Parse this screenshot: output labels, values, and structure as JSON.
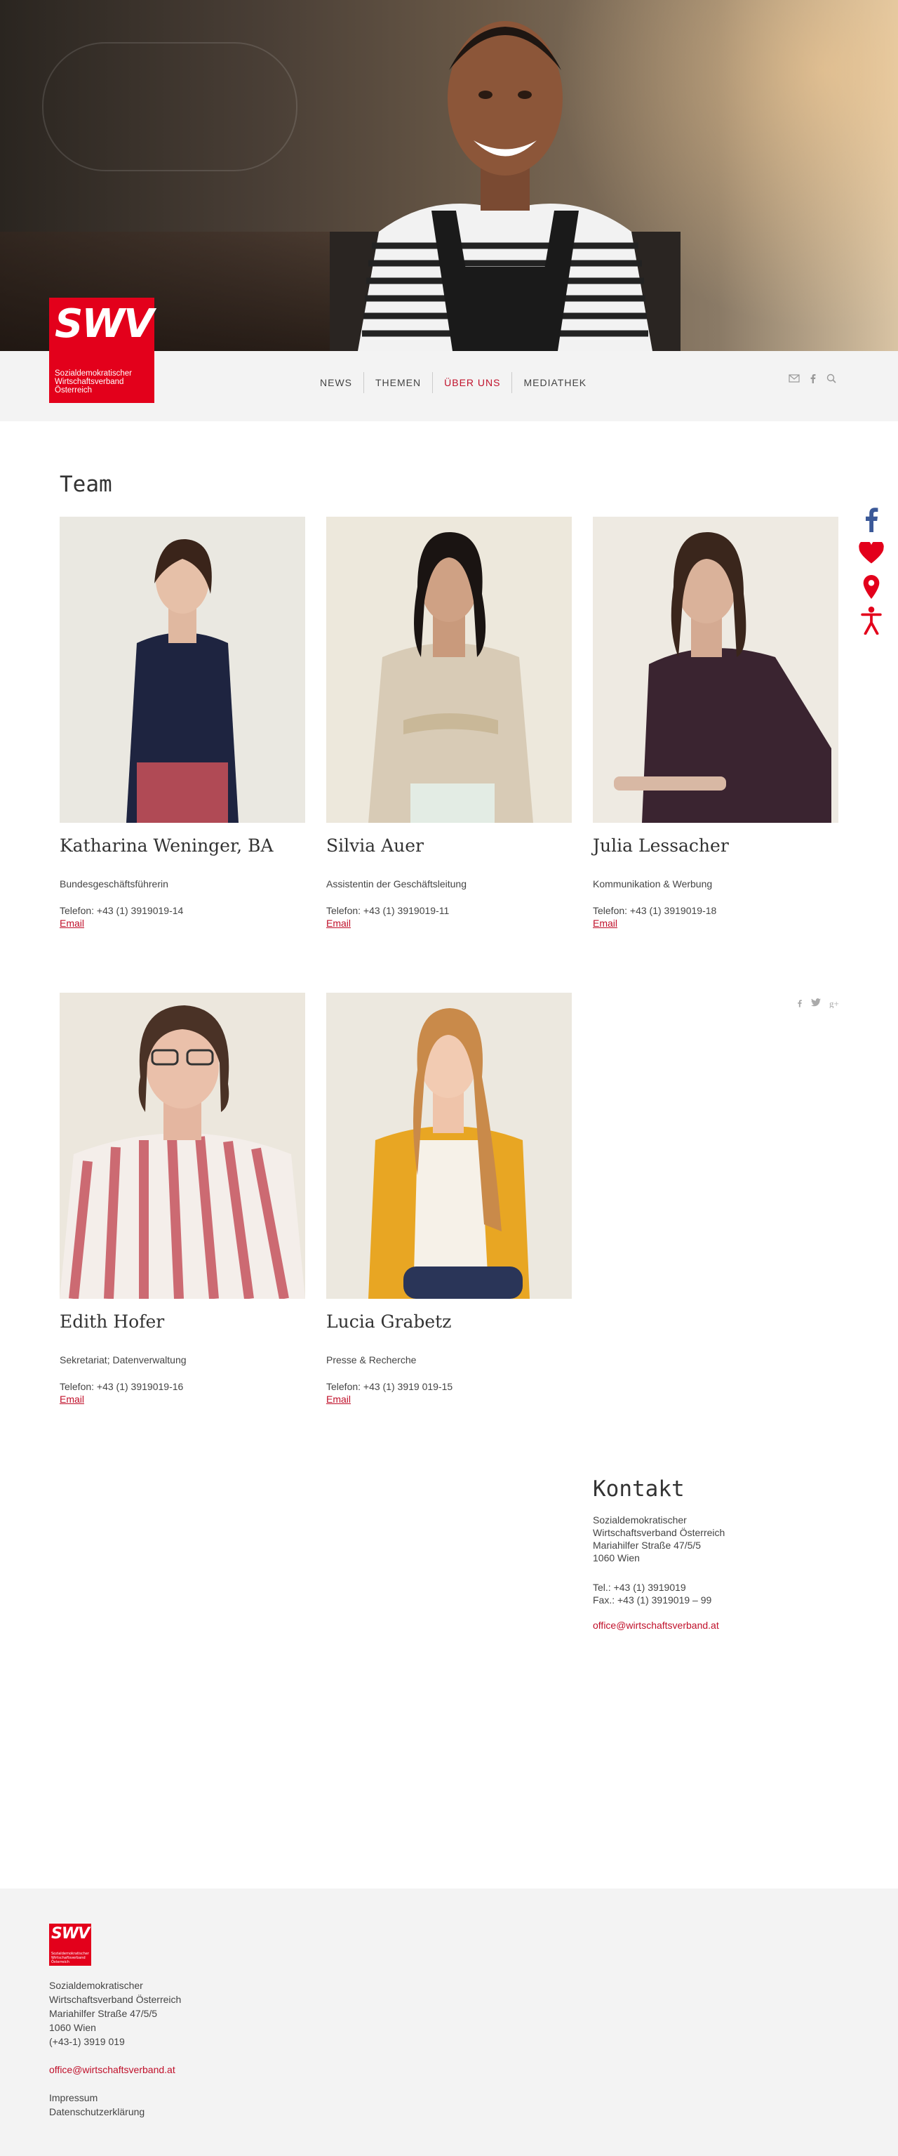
{
  "brand": {
    "mark": "SWV",
    "subtitle_lines": [
      "Sozialdemokratischer",
      "Wirtschaftsverband",
      "Österreich"
    ],
    "color": "#e3001b"
  },
  "nav": {
    "items": [
      "NEWS",
      "THEMEN",
      "ÜBER UNS",
      "MEDIATHEK"
    ],
    "active": "ÜBER UNS"
  },
  "nav_icons": [
    "mail-icon",
    "facebook-icon",
    "search-icon"
  ],
  "side_icons": [
    "facebook-icon",
    "heart-icon",
    "location-pin-icon",
    "accessibility-icon"
  ],
  "team": {
    "heading": "Team",
    "members": [
      {
        "name": "Katharina Weninger, BA",
        "role": "Bundesgeschäftsführerin",
        "phone": "Telefon: +43 (1) 3919019-14",
        "email_label": "Email"
      },
      {
        "name": "Silvia Auer",
        "role": "Assistentin der Geschäftsleitung",
        "phone": "Telefon: +43 (1) 3919019-11",
        "email_label": "Email"
      },
      {
        "name": "Julia Lessacher",
        "role": "Kommunikation & Werbung",
        "phone": "Telefon: +43 (1) 3919019-18",
        "email_label": "Email"
      },
      {
        "name": "Edith Hofer",
        "role": "Sekretariat; Datenverwaltung",
        "phone": "Telefon: +43 (1) 3919019-16",
        "email_label": "Email"
      },
      {
        "name": "Lucia Grabetz",
        "role": "Presse & Recherche",
        "phone": "Telefon: +43 (1) 3919 019-15",
        "email_label": "Email"
      }
    ]
  },
  "share_icons": [
    "facebook-icon",
    "twitter-icon",
    "google-plus-icon"
  ],
  "contact": {
    "heading": "Kontakt",
    "address_lines": [
      "Sozialdemokratischer",
      "Wirtschaftsverband Österreich",
      "Mariahilfer Straße 47/5/5",
      "1060 Wien"
    ],
    "tel": "Tel.: +43 (1) 3919019",
    "fax": "Fax.: +43 (1) 3919019 – 99",
    "email": "office@wirtschaftsverband.at"
  },
  "footer": {
    "address_lines": [
      "Sozialdemokratischer",
      "Wirtschaftsverband Österreich",
      "Mariahilfer Straße 47/5/5",
      "1060 Wien",
      "(+43-1) 3919 019"
    ],
    "email": "office@wirtschaftsverband.at",
    "links": [
      "Impressum",
      "Datenschutzerklärung"
    ]
  }
}
